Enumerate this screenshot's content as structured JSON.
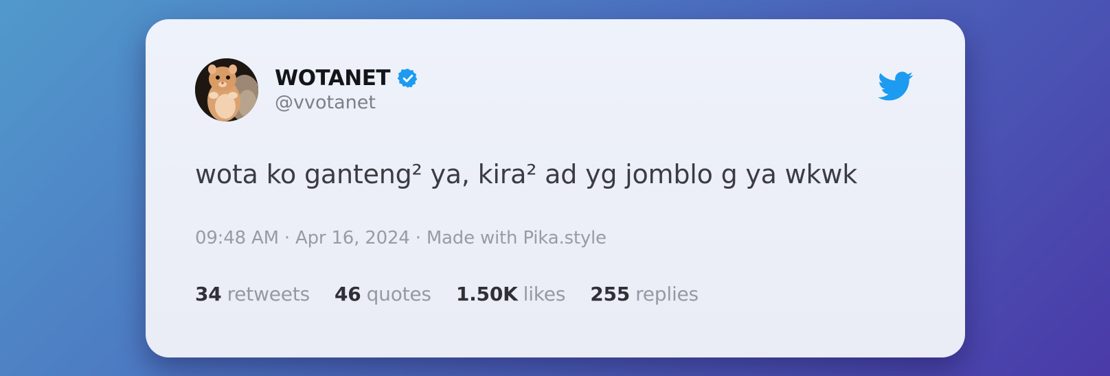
{
  "tweet": {
    "author": {
      "display_name": "WOTANET",
      "handle": "@vvotanet",
      "verified": true,
      "avatar_icon": "hamster-avatar"
    },
    "brand_icon": "twitter-bird-icon",
    "text": "wota ko ganteng² ya, kira² ad yg jomblo g ya wkwk",
    "meta": "09:48 AM · Apr 16, 2024 · Made with Pika.style",
    "stats": [
      {
        "value": "34",
        "label": "retweets"
      },
      {
        "value": "46",
        "label": "quotes"
      },
      {
        "value": "1.50K",
        "label": "likes"
      },
      {
        "value": "255",
        "label": "replies"
      }
    ]
  },
  "colors": {
    "twitter_blue": "#1d9bf0",
    "verified_blue": "#1d9bf0"
  }
}
